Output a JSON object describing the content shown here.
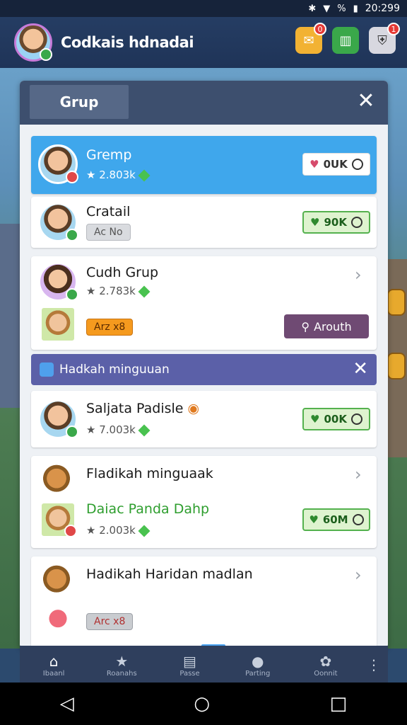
{
  "status_bar": {
    "time": "20:299",
    "battery": "%",
    "icons": [
      "bluetooth-icon",
      "wifi-icon",
      "signal-icon",
      "battery-icon"
    ]
  },
  "app_header": {
    "title": "Codkais hdnadai",
    "icons": [
      {
        "name": "chat-icon",
        "badge": "0",
        "color": "#f2b233"
      },
      {
        "name": "chart-icon",
        "badge": "",
        "color": "#3aa84a"
      },
      {
        "name": "shield-icon",
        "badge": "1",
        "color": "#d8d8e0"
      }
    ]
  },
  "modal": {
    "tab_label": "Grup",
    "close_glyph": "✕",
    "cards": [
      {
        "title": "Gremp",
        "subtitle": "2.803k",
        "price": "0UK",
        "style": "blue"
      },
      {
        "title": "Cratail",
        "tag": "Ac No",
        "price": "90K"
      },
      {
        "title": "Cudh Grup",
        "subtitle": "2.783k",
        "tag": "Arz x8",
        "button": "Arouth"
      },
      {
        "title": "Saljata Padisle",
        "subtitle": "7.003k",
        "price": "00K"
      },
      {
        "title": "Fladikah minguaak",
        "title2": "Daiac Panda Dahp",
        "subtitle": "2.003k",
        "price": "60M"
      },
      {
        "title": "Hadikah Haridan madlan",
        "tag": "Arc x8"
      }
    ],
    "banner": {
      "text": "Hadkah minguuan",
      "close_glyph": "✕"
    }
  },
  "bottom_nav": {
    "items": [
      {
        "label": "Ibaanl",
        "icon": "home-icon",
        "glyph": "⌂"
      },
      {
        "label": "Roanahs",
        "icon": "star-icon",
        "glyph": "★"
      },
      {
        "label": "Passe",
        "icon": "store-icon",
        "glyph": "▤"
      },
      {
        "label": "Parting",
        "icon": "chat-bubble-icon",
        "glyph": "●"
      },
      {
        "label": "Oonnit",
        "icon": "gear-icon",
        "glyph": "✿"
      }
    ],
    "more_glyph": "⋮"
  },
  "system_nav": {
    "back": "◁",
    "home": "○",
    "recents": "□"
  }
}
